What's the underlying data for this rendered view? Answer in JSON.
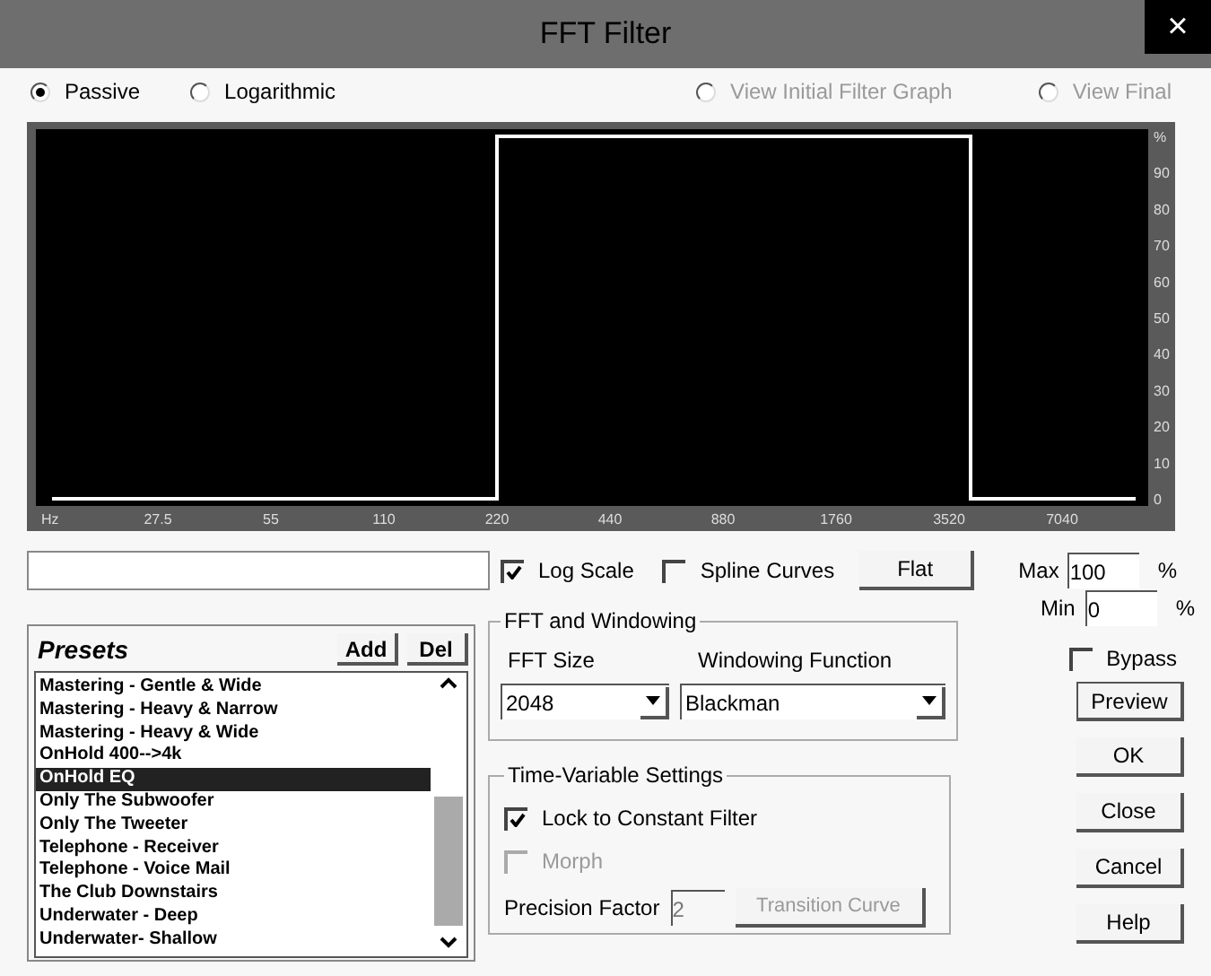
{
  "window": {
    "title": "FFT Filter",
    "close": "×"
  },
  "mode_radios": [
    {
      "label": "Passive",
      "selected": true
    },
    {
      "label": "Logarithmic",
      "selected": false
    }
  ],
  "view_radios": [
    {
      "label": "View Initial Filter Graph",
      "selected": false,
      "disabled": true
    },
    {
      "label": "View Final",
      "selected": false,
      "disabled": true
    }
  ],
  "graph": {
    "x_labels": [
      "Hz",
      "27.5",
      "55",
      "110",
      "220",
      "440",
      "880",
      "1760",
      "3520",
      "7040"
    ],
    "y_labels": [
      "%",
      "90",
      "80",
      "70",
      "60",
      "50",
      "40",
      "30",
      "20",
      "10",
      "0"
    ]
  },
  "log_scale": {
    "label": "Log Scale",
    "checked": true
  },
  "spline_curves": {
    "label": "Spline Curves",
    "checked": false
  },
  "flat_button": "Flat",
  "max": {
    "label": "Max",
    "value": "100",
    "unit": "%"
  },
  "min": {
    "label": "Min",
    "value": "0",
    "unit": "%"
  },
  "presets": {
    "title": "Presets",
    "add": "Add",
    "del": "Del",
    "items": [
      {
        "label": "Mastering - Gentle & Wide",
        "selected": false
      },
      {
        "label": "Mastering - Heavy & Narrow",
        "selected": false
      },
      {
        "label": "Mastering - Heavy & Wide",
        "selected": false
      },
      {
        "label": "OnHold 400-->4k",
        "selected": false
      },
      {
        "label": "OnHold EQ",
        "selected": true
      },
      {
        "label": "Only The Subwoofer",
        "selected": false
      },
      {
        "label": "Only The Tweeter",
        "selected": false
      },
      {
        "label": "Telephone - Receiver",
        "selected": false
      },
      {
        "label": "Telephone - Voice Mail",
        "selected": false
      },
      {
        "label": "The Club Downstairs",
        "selected": false
      },
      {
        "label": "Underwater - Deep",
        "selected": false
      },
      {
        "label": "Underwater- Shallow",
        "selected": false
      }
    ]
  },
  "fft": {
    "title": "FFT and Windowing",
    "size_label": "FFT Size",
    "size_value": "2048",
    "window_label": "Windowing Function",
    "window_value": "Blackman"
  },
  "time_variable": {
    "title": "Time-Variable Settings",
    "lock": {
      "label": "Lock to Constant Filter",
      "checked": true,
      "disabled": false
    },
    "morph": {
      "label": "Morph",
      "checked": false,
      "disabled": true
    },
    "precision_label": "Precision Factor",
    "precision_value": "2",
    "transition_button": {
      "label": "Transition Curve",
      "disabled": true
    }
  },
  "bypass": {
    "label": "Bypass",
    "checked": false
  },
  "buttons": [
    "Preview",
    "OK",
    "Close",
    "Cancel",
    "Help"
  ]
}
